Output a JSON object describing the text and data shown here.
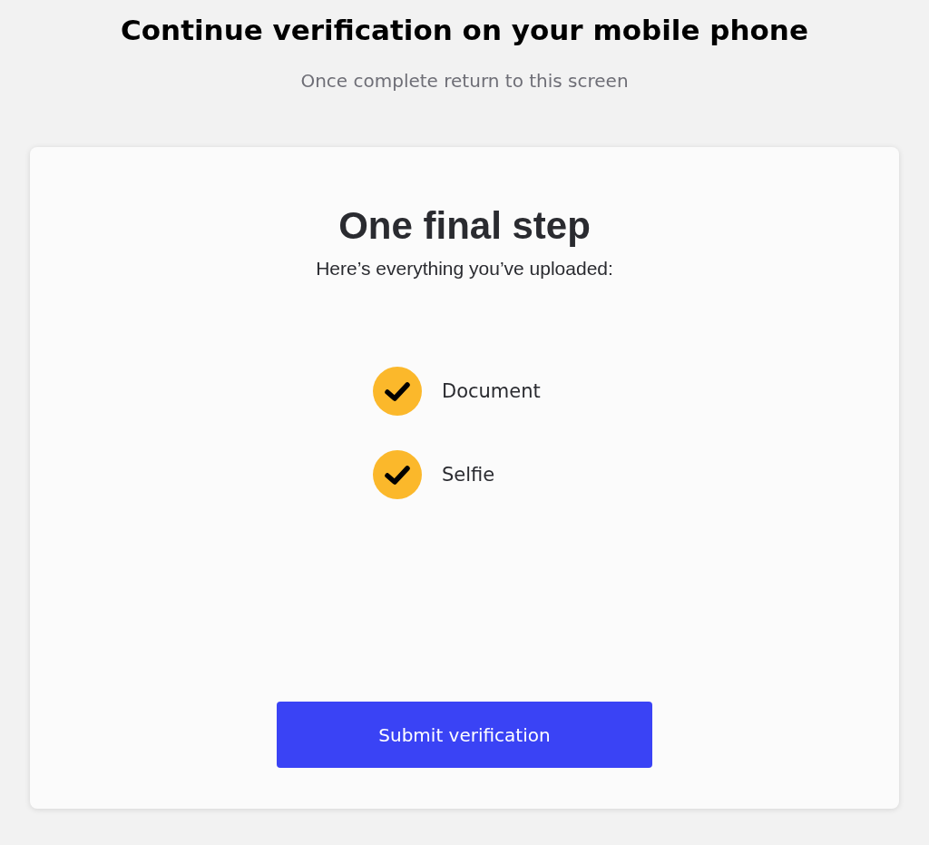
{
  "header": {
    "title": "Continue verification on your mobile phone",
    "subtitle": "Once complete return to this screen"
  },
  "card": {
    "title": "One final step",
    "subtitle": "Here’s everything you’ve uploaded:",
    "items": [
      {
        "label": "Document",
        "checked": true
      },
      {
        "label": "Selfie",
        "checked": true
      }
    ],
    "button": "Submit verification"
  }
}
